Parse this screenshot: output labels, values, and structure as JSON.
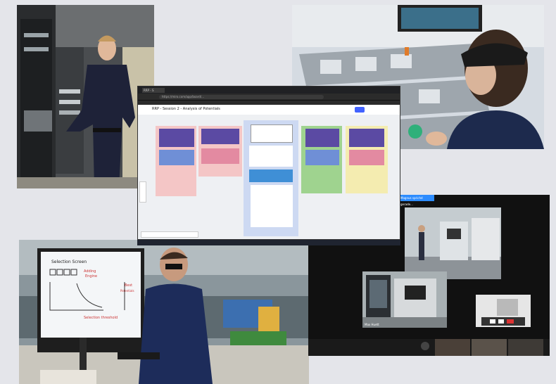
{
  "browser": {
    "tab_label": "RRP - S",
    "url": "https://miro.com/app/board/...",
    "board_title": "RRP - Session 2 - Analysis of Potentials"
  },
  "zoom": {
    "title": "Magnus sprichd gerade...",
    "name_1": "Bhav Sha",
    "name_2": "Max Huett"
  },
  "whiteboard": {
    "title": "Selection Screen",
    "notes": [
      "Adding",
      "Engine",
      "Best",
      "Potentials",
      "Selection threshold"
    ]
  },
  "colors": {
    "miro_blue": "#4262ff",
    "pink": "#f4c6c6",
    "blue": "#cdd9f2",
    "green": "#9fd38f",
    "yellow": "#f4ecb0",
    "zoom_bg": "#111111"
  }
}
